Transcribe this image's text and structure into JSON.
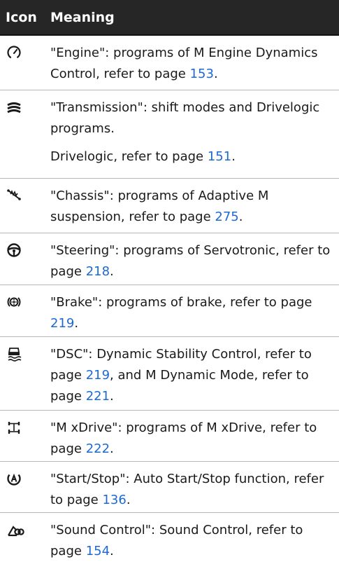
{
  "table": {
    "headers": {
      "icon": "Icon",
      "meaning": "Meaning"
    },
    "rows": [
      {
        "icon": "engine-gauge-icon",
        "paragraphs": [
          {
            "text": "\"Engine\": programs of M Engine Dy­namics Control, refer to page ",
            "page": "153",
            "after": "."
          }
        ]
      },
      {
        "icon": "transmission-icon",
        "paragraphs": [
          {
            "text": "\"Transmission\": shift modes and Drive­logic programs.",
            "page": "",
            "after": ""
          },
          {
            "text": "Drivelogic, refer to page ",
            "page": "151",
            "after": "."
          }
        ]
      },
      {
        "icon": "chassis-shock-icon",
        "paragraphs": [
          {
            "text": "\"Chassis\": programs of Adaptive M suspension, refer to page ",
            "page": "275",
            "after": "."
          }
        ]
      },
      {
        "icon": "steering-wheel-icon",
        "paragraphs": [
          {
            "text": "\"Steering\": programs of Servotronic, re­fer to page ",
            "page": "218",
            "after": "."
          }
        ]
      },
      {
        "icon": "brake-disc-icon",
        "paragraphs": [
          {
            "text": "\"Brake\": programs of brake, refer to page ",
            "page": "219",
            "after": "."
          }
        ]
      },
      {
        "icon": "dsc-car-icon",
        "paragraphs": [
          {
            "text": "\"DSC\": Dynamic Stability Control, refer to page ",
            "page": "219",
            "after": ", and M Dynamic Mode, re­fer to page "
          },
          {
            "text": "",
            "page": "221",
            "after": "."
          }
        ]
      },
      {
        "icon": "xdrive-axle-icon",
        "paragraphs": [
          {
            "text": "\"M xDrive\": programs of M xDrive, refer to page ",
            "page": "222",
            "after": "."
          }
        ]
      },
      {
        "icon": "auto-start-stop-icon",
        "paragraphs": [
          {
            "text": "\"Start/Stop\": Auto Start/Stop function, refer to page ",
            "page": "136",
            "after": "."
          }
        ]
      },
      {
        "icon": "sound-control-icon",
        "paragraphs": [
          {
            "text": "\"Sound Control\": Sound Control, refer to page ",
            "page": "154",
            "after": "."
          }
        ]
      }
    ]
  },
  "colors": {
    "header_bg": "#262626",
    "header_text": "#ffffff",
    "link": "#1c69d4",
    "divider": "#b7b7b7"
  }
}
